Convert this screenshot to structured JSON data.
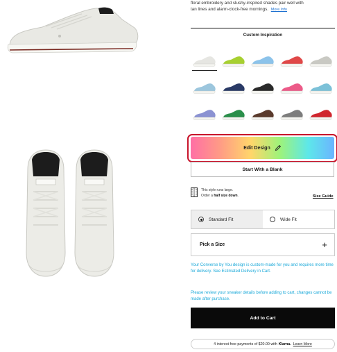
{
  "product": {
    "description_line1": "floral embroidery and slushy-inspired shades pair well with",
    "description_line2": "tan lines and alarm-clock-free mornings.",
    "more_info_label": "More Info",
    "colors": {
      "shoe_body": "#e9e9e4",
      "sole": "#f6f6f2",
      "rubber_stripe": "#7a2a22",
      "tongue_label": "#1c1c1c"
    }
  },
  "inspiration": {
    "title": "Custom Inspiration",
    "selected_index": 0,
    "swatches": [
      {
        "name": "white-sneaker",
        "color": "#e6e6e2"
      },
      {
        "name": "lime-sneaker",
        "color": "#a7d031"
      },
      {
        "name": "sky-sneaker",
        "color": "#8cc3ea"
      },
      {
        "name": "red-sneaker",
        "color": "#e04848"
      },
      {
        "name": "grey-sneaker",
        "color": "#c9c9c3"
      },
      {
        "name": "light-blue-sneaker",
        "color": "#9cc6dd"
      },
      {
        "name": "navy-sneaker",
        "color": "#2a3a66"
      },
      {
        "name": "black-gold-sneaker",
        "color": "#2a2a2a"
      },
      {
        "name": "pink-sneaker",
        "color": "#ec5a88"
      },
      {
        "name": "aqua-sneaker",
        "color": "#7cc1d8"
      },
      {
        "name": "periwinkle-sneaker",
        "color": "#8b92d2"
      },
      {
        "name": "green-sneaker",
        "color": "#2b8f4b"
      },
      {
        "name": "brown-sneaker",
        "color": "#5a3a2c"
      },
      {
        "name": "dark-grey-sneaker",
        "color": "#7d7d7d"
      },
      {
        "name": "crimson-sneaker",
        "color": "#d0262e"
      }
    ]
  },
  "actions": {
    "edit_design_label": "Edit Design",
    "start_blank_label": "Start With a Blank",
    "add_to_cart_label": "Add to Cart"
  },
  "sizing": {
    "note_line1": "This style runs large.",
    "note_line2_prefix": "Order a ",
    "note_line2_bold": "half size down",
    "note_line2_suffix": ".",
    "size_guide_label": "Size Guide",
    "fit_options": [
      {
        "label": "Standard Fit",
        "selected": true
      },
      {
        "label": "Wide Fit",
        "selected": false
      }
    ],
    "pick_size_label": "Pick a Size"
  },
  "notices": {
    "custom_made": "Your Converse by You design is custom-made for you and requires more time for delivery. See Estimated Delivery in Cart.",
    "review": "Please review your sneaker details before adding to cart, changes cannot be made after purchase."
  },
  "payments": {
    "prefix": "4 interest-free payments of $20.00 with",
    "provider": "Klarna.",
    "learn_more_label": "Learn More"
  },
  "colors": {
    "highlight_outline": "#c8142b",
    "notice_text": "#1ba9d9",
    "cart_button": "#0a0a0a",
    "link": "#1a6fd0"
  }
}
